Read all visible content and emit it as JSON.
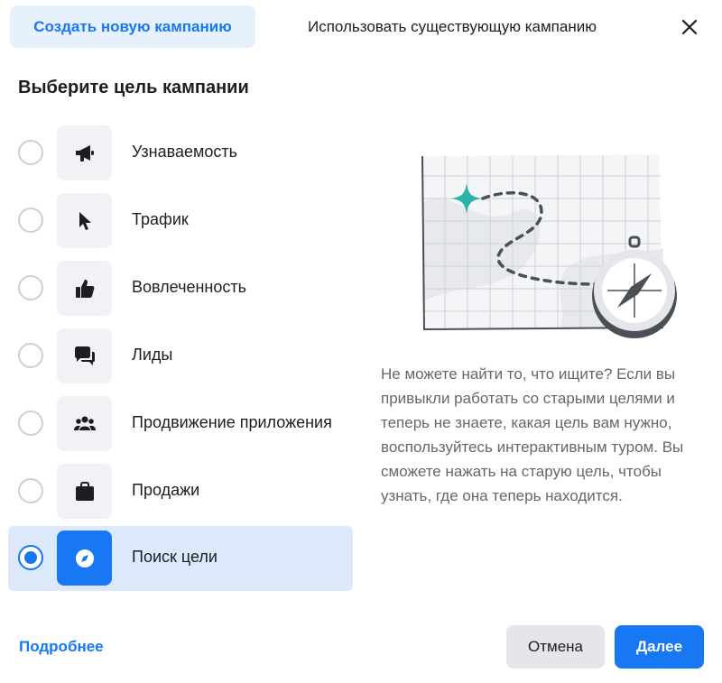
{
  "tabs": {
    "create_label": "Создать новую кампанию",
    "existing_label": "Использовать существующую кампанию"
  },
  "heading": "Выберите цель кампании",
  "objectives": [
    {
      "label": "Узнаваемость",
      "icon": "megaphone-icon",
      "selected": false
    },
    {
      "label": "Трафик",
      "icon": "cursor-icon",
      "selected": false
    },
    {
      "label": "Вовлеченность",
      "icon": "thumbs-up-icon",
      "selected": false
    },
    {
      "label": "Лиды",
      "icon": "chat-bubbles-icon",
      "selected": false
    },
    {
      "label": "Продвижение приложения",
      "icon": "people-icon",
      "selected": false
    },
    {
      "label": "Продажи",
      "icon": "shopping-bag-icon",
      "selected": false
    },
    {
      "label": "Поиск цели",
      "icon": "compass-icon",
      "selected": true
    }
  ],
  "help_text": "Не можете найти то, что ищите? Если вы привыкли работать со старыми целями и теперь не знаете, какая цель вам нужно, воспользуйтесь интерактивным туром. Вы сможете нажать на старую цель, чтобы узнать, где она теперь находится.",
  "footer": {
    "more_link": "Подробнее",
    "cancel_label": "Отмена",
    "next_label": "Далее"
  },
  "colors": {
    "accent": "#1877f2",
    "selected_bg": "#dce9fb",
    "icon_bg": "#f0f2f5",
    "map_star": "#2ab3a6"
  }
}
